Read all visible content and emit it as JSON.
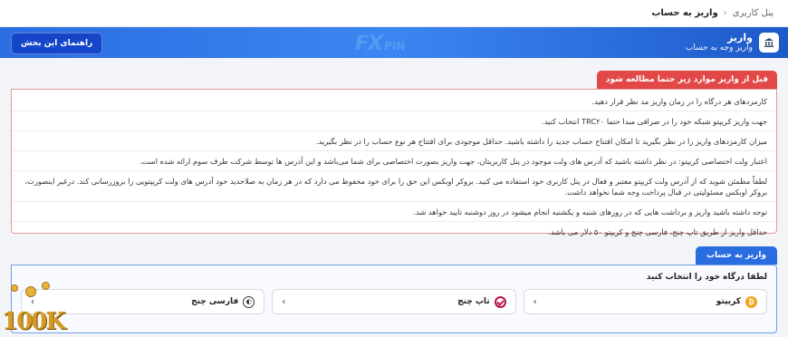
{
  "breadcrumb": {
    "root": "پنل کاربری",
    "current": "واریز به حساب"
  },
  "header": {
    "title": "واریز",
    "subtitle": "واریز وجه به حساب",
    "guide_button": "راهنمای این بخش"
  },
  "logo": {
    "fx": "FX",
    "pin": "PIN"
  },
  "warning": {
    "title": "قبل از واریز موارد زیر حتما مطالعه شود",
    "items": [
      "کارمزدهای هر درگاه را در زمان واریز مد نظر قرار دهید.",
      "جهت واریز کریپتو شبکه خود را در صرافی مبدا حتما TRC۲۰ انتخاب کنید.",
      "میزان کارمزدهای واریز را در نظر بگیرید تا امکان افتتاح حساب جدید را داشته باشید. حداقل موجودی برای افتتاح هر نوع حساب را در نظر بگیرید.",
      "اعتبار ولت اختصاصی کریپتو: در نظر داشته باشید که آدرس های ولت موجود در پنل کاربریتان، جهت واریز بصورت اختصاصی برای شما می‌باشد و این آدرس ها توسط شرکت طرف سوم ارائه شده است.",
      "لطفاً مطمئن شوید که از آدرس ولت کریپتو معتبر و فعال در پنل کاربری خود استفاده می کنید. بروکر اوبکس این حق را برای خود محفوظ می دارد که در هر زمان به صلاحدید خود آدرس های ولت کریپتویی را بروزرسانی کند. درغیر اینصورت، بروکر اوبکس مسئولیتی در قبال پرداخت وجه شما نخواهد داشت.",
      "توجه داشته باشید واریز و برداشت هایی که در روزهای شنبه و یکشنبه انجام میشود در روز دوشنبه تایید خواهد شد.",
      "حداقل واریز از طریق تاپ چنج، فارسی چنج و کریپتو ۵۰ دلار می باشد."
    ]
  },
  "deposit": {
    "tab_label": "واریز به حساب",
    "prompt": "لطفا درگاه خود را انتخاب کنید",
    "gateways": [
      {
        "name": "کریپتو",
        "icon": "bitcoin-icon"
      },
      {
        "name": "تاپ چنج",
        "icon": "topchange-icon"
      },
      {
        "name": "فارسی چنج",
        "icon": "farsichange-icon"
      }
    ]
  },
  "watermark": "100K",
  "colors": {
    "header_blue": "#2a6de0",
    "warning_red": "#e34848",
    "guide_button": "#1545c9",
    "bitcoin_orange": "#f2a31a"
  }
}
